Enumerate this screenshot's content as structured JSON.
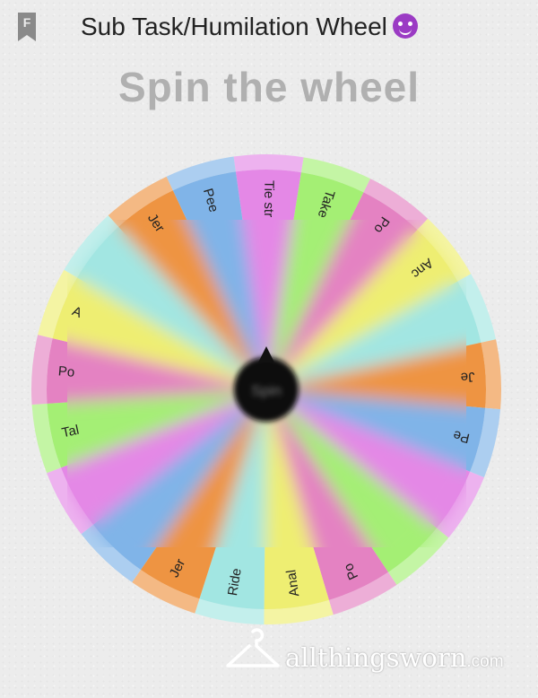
{
  "header": {
    "bookmark_letter": "F",
    "title": "Sub Task/Humilation Wheel",
    "title_emoji": "smiling-devil-emoji"
  },
  "heading": "Spin the wheel",
  "wheel": {
    "center_label": "Spin",
    "segments": [
      {
        "label": "Tie str",
        "color": "#e488e6"
      },
      {
        "label": "Take",
        "color": "#a4ef74"
      },
      {
        "label": "Po",
        "color": "#e482c2"
      },
      {
        "label": "Anc",
        "color": "#eeee72"
      },
      {
        "label": "",
        "color": "#a2e6e2"
      },
      {
        "label": "Je",
        "color": "#ee9442"
      },
      {
        "label": "Pe",
        "color": "#80b4e8"
      },
      {
        "label": "",
        "color": "#e488e6"
      },
      {
        "label": "",
        "color": "#a4ef74"
      },
      {
        "label": "Po",
        "color": "#e482c2"
      },
      {
        "label": "Anal",
        "color": "#eeee72"
      },
      {
        "label": "Ride",
        "color": "#a2e6e2"
      },
      {
        "label": "Jer",
        "color": "#ee9442"
      },
      {
        "label": "",
        "color": "#80b4e8"
      },
      {
        "label": "",
        "color": "#e488e6"
      },
      {
        "label": "Tal",
        "color": "#a4ef74"
      },
      {
        "label": "Po",
        "color": "#e482c2"
      },
      {
        "label": "A",
        "color": "#eeee72"
      },
      {
        "label": "",
        "color": "#a2e6e2"
      },
      {
        "label": "Jer",
        "color": "#ee9442"
      },
      {
        "label": "Pee",
        "color": "#80b4e8"
      }
    ]
  },
  "watermark": {
    "brand": "allthingsworn",
    "suffix": ".com",
    "icon": "hanger-icon"
  }
}
